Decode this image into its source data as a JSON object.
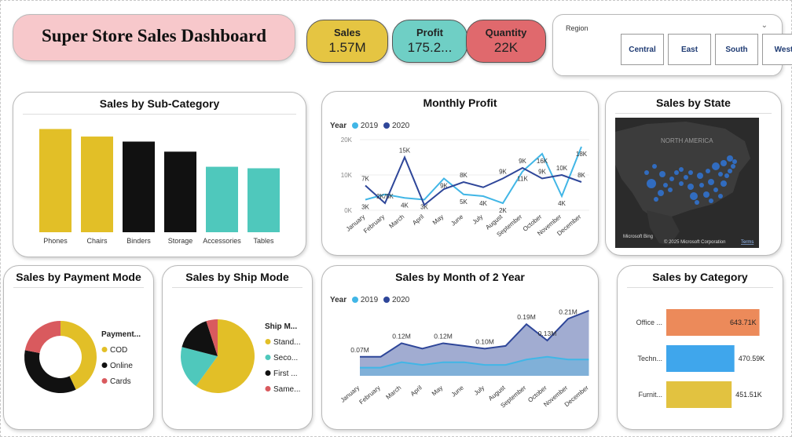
{
  "header": {
    "title": "Super Store Sales Dashboard"
  },
  "kpis": [
    {
      "label": "Sales",
      "value": "1.57M",
      "color": "#e5c542"
    },
    {
      "label": "Profit",
      "value": "175.2...",
      "color": "#6fcfc5"
    },
    {
      "label": "Quantity",
      "value": "22K",
      "color": "#e0696d"
    }
  ],
  "region": {
    "label": "Region",
    "options": [
      "Central",
      "East",
      "South",
      "West"
    ]
  },
  "colors": {
    "yellow": "#e2bf27",
    "teal": "#4fc8bc",
    "black": "#111111",
    "red": "#d95a5e",
    "light_blue": "#41b6e6",
    "dark_blue": "#2e4699",
    "orange": "#ec8a5a",
    "blue": "#3fa6ec"
  },
  "chart_data": [
    {
      "id": "sub_category",
      "type": "bar",
      "title": "Sales by Sub-Category",
      "categories": [
        "Phones",
        "Chairs",
        "Binders",
        "Storage",
        "Accessories",
        "Tables"
      ],
      "values": [
        205,
        190,
        180,
        160,
        130,
        127
      ],
      "colors": [
        "#e2bf27",
        "#e2bf27",
        "#111111",
        "#111111",
        "#4fc8bc",
        "#4fc8bc"
      ],
      "ylim": [
        0,
        215
      ]
    },
    {
      "id": "monthly_profit",
      "type": "line",
      "title": "Monthly Profit",
      "legend_title": "Year",
      "y_ticks": [
        "0K",
        "10K",
        "20K"
      ],
      "ylim": [
        0,
        20
      ],
      "categories": [
        "January",
        "February",
        "March",
        "April",
        "May",
        "June",
        "July",
        "August",
        "September",
        "October",
        "November",
        "December"
      ],
      "series": [
        {
          "name": "2019",
          "color": "#41b6e6",
          "values": [
            3,
            4.5,
            3.5,
            3,
            9,
            4.5,
            4,
            2,
            11,
            16,
            4,
            18
          ],
          "labels": [
            "3K",
            "",
            "4K",
            "3K",
            "9K",
            "5K",
            "4K",
            "2K",
            "11K",
            "16K",
            "4K",
            "18K"
          ]
        },
        {
          "name": "2020",
          "color": "#2e4699",
          "values": [
            7,
            2,
            15,
            1.5,
            6,
            8,
            6.5,
            9,
            12,
            9,
            10,
            8
          ],
          "labels": [
            "7K",
            "2K/5K",
            "15K",
            "",
            "",
            "8K",
            "",
            "9K",
            "9K",
            "9K",
            "10K",
            "8K"
          ]
        }
      ]
    },
    {
      "id": "month_2_year",
      "type": "area",
      "title": "Sales by Month of 2 Year",
      "legend_title": "Year",
      "ylim": [
        0,
        0.26
      ],
      "categories": [
        "January",
        "February",
        "March",
        "April",
        "May",
        "June",
        "July",
        "August",
        "September",
        "October",
        "November",
        "December"
      ],
      "series": [
        {
          "name": "2019",
          "color": "#41b6e6",
          "values": [
            0.03,
            0.03,
            0.05,
            0.04,
            0.05,
            0.05,
            0.04,
            0.04,
            0.06,
            0.07,
            0.06,
            0.06
          ]
        },
        {
          "name": "2020",
          "color": "#2e4699",
          "values": [
            0.07,
            0.07,
            0.12,
            0.1,
            0.12,
            0.11,
            0.1,
            0.11,
            0.19,
            0.13,
            0.21,
            0.24
          ]
        }
      ],
      "data_labels": [
        "0.07M",
        "",
        "0.12M",
        "",
        "0.12M",
        "",
        "0.10M",
        "",
        "0.19M",
        "0.13M",
        "0.21M",
        ""
      ]
    },
    {
      "id": "payment_mode",
      "type": "pie",
      "title": "Sales by Payment Mode",
      "legend_title": "Payment...",
      "donut": true,
      "slices": [
        {
          "label": "COD",
          "value": 43,
          "color": "#e2bf27"
        },
        {
          "label": "Online",
          "value": 35,
          "color": "#111111"
        },
        {
          "label": "Cards",
          "value": 22,
          "color": "#d95a5e"
        }
      ]
    },
    {
      "id": "ship_mode",
      "type": "pie",
      "title": "Sales by Ship Mode",
      "legend_title": "Ship M...",
      "donut": false,
      "slices": [
        {
          "label": "Stand...",
          "value": 60,
          "color": "#e2bf27"
        },
        {
          "label": "Seco...",
          "value": 19,
          "color": "#4fc8bc"
        },
        {
          "label": "First ...",
          "value": 16,
          "color": "#111111"
        },
        {
          "label": "Same...",
          "value": 5,
          "color": "#d95a5e"
        }
      ]
    },
    {
      "id": "category",
      "type": "bar",
      "title": "Sales by Category",
      "orientation": "horizontal",
      "categories": [
        "Office ...",
        "Techn...",
        "Furnit..."
      ],
      "values": [
        643.71,
        470.59,
        451.51
      ],
      "labels": [
        "643.71K",
        "470.59K",
        "451.51K"
      ],
      "colors": [
        "#ec8a5a",
        "#3fa6ec",
        "#e2c240"
      ],
      "xlim": [
        0,
        760
      ]
    }
  ],
  "map": {
    "title": "Sales by State",
    "region_label": "NORTH AMERICA",
    "attribution": "Microsoft Bing",
    "copyright": "© 2025 Microsoft Corporation",
    "terms": "Terms"
  }
}
